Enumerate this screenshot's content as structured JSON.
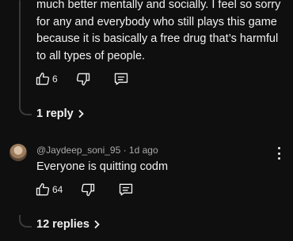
{
  "comment1": {
    "text": "much better mentally and socially. I feel so sorry for any and everybody who still plays this game because it is basically a free drug that’s harmful to all types of people.",
    "likes": "6",
    "replies_link": "1 reply"
  },
  "comment2": {
    "meta": "@Jaydeep_soni_95 · 1d ago",
    "text": "Everyone is quitting codm",
    "likes": "64",
    "replies_link": "12 replies"
  }
}
